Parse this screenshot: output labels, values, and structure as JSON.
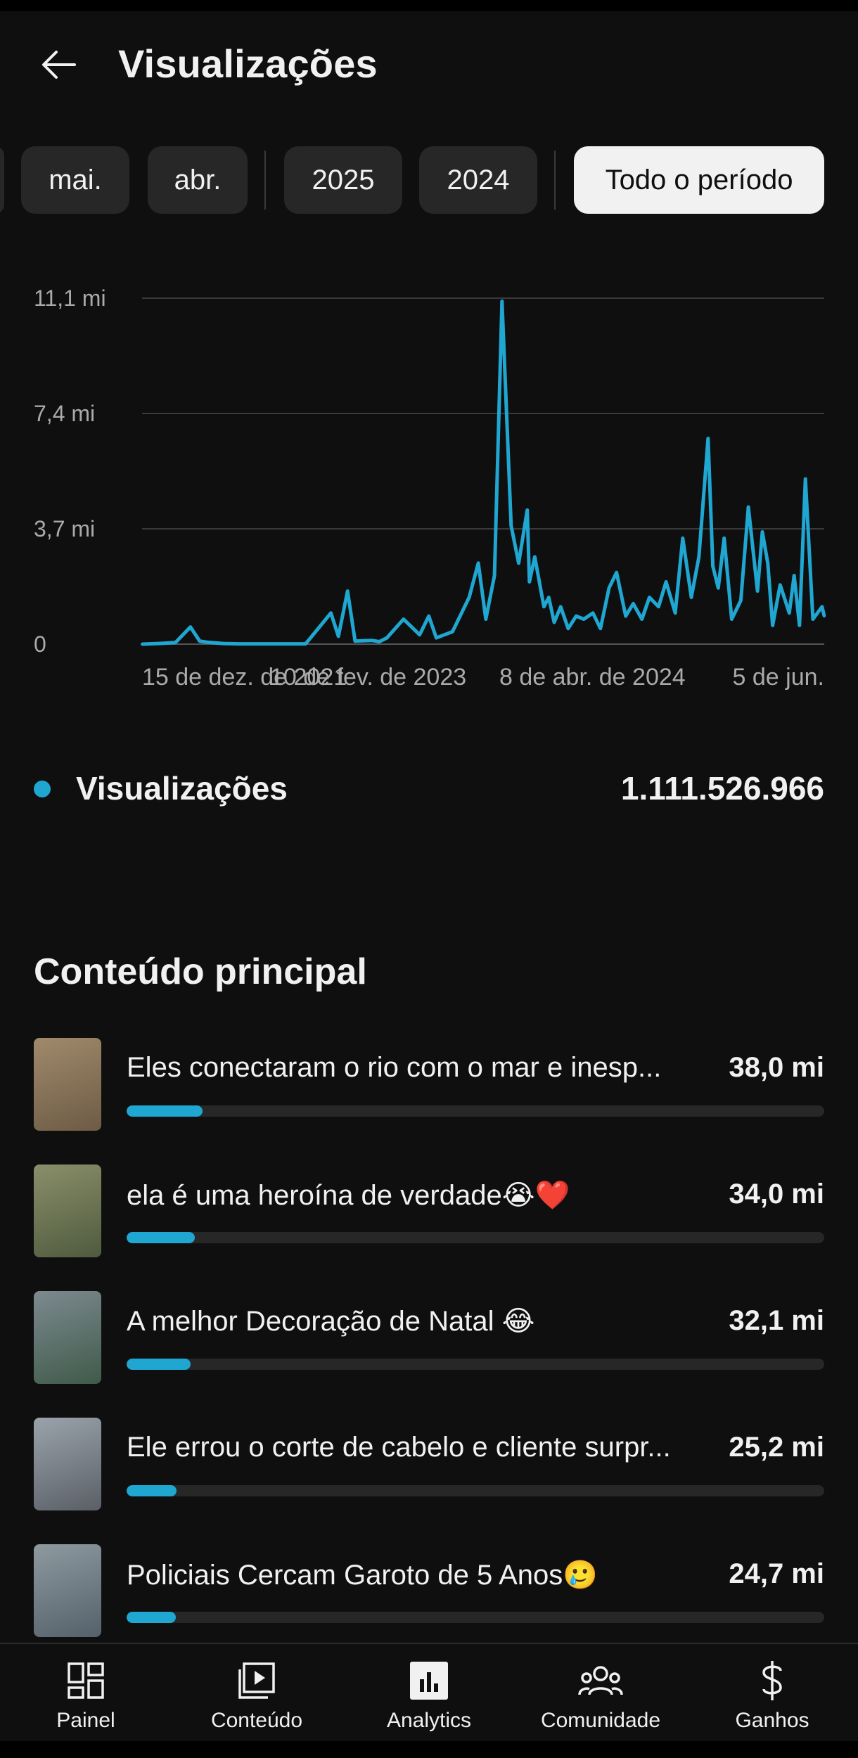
{
  "header": {
    "title": "Visualizações"
  },
  "chips": [
    "mai.",
    "abr.",
    "2025",
    "2024",
    "Todo o período"
  ],
  "chart_data": {
    "type": "line",
    "title": "",
    "xlabel": "",
    "ylabel": "",
    "y_ticks": [
      "11,1 mi",
      "7,4 mi",
      "3,7 mi",
      "0"
    ],
    "x_ticks": [
      "15 de dez. de 2021",
      "10 de fev. de 2023",
      "8 de abr. de 2024",
      "5 de jun."
    ],
    "ylim": [
      0,
      11100000
    ],
    "series_color": "#1fa6d1",
    "series": [
      {
        "name": "",
        "x": [
          "2021-12-15",
          "2022-01-15",
          "2022-02-15",
          "2022-03-15",
          "2022-04-01",
          "2022-04-15",
          "2022-05-01",
          "2022-05-15",
          "2022-06-15",
          "2022-08-15",
          "2022-10-15",
          "2022-12-01",
          "2022-12-15",
          "2023-01-01",
          "2023-01-15",
          "2023-02-15",
          "2023-03-01",
          "2023-03-15",
          "2023-04-15",
          "2023-05-15",
          "2023-06-01",
          "2023-06-15",
          "2023-07-15",
          "2023-08-15",
          "2023-09-01",
          "2023-09-15",
          "2023-10-01",
          "2023-10-15",
          "2023-11-01",
          "2023-11-15",
          "2023-12-01",
          "2023-12-05",
          "2023-12-15",
          "2024-01-01",
          "2024-01-10",
          "2024-01-20",
          "2024-02-01",
          "2024-02-15",
          "2024-03-01",
          "2024-03-15",
          "2024-04-01",
          "2024-04-15",
          "2024-05-01",
          "2024-05-15",
          "2024-06-01",
          "2024-06-15",
          "2024-07-01",
          "2024-07-15",
          "2024-08-01",
          "2024-08-15",
          "2024-09-01",
          "2024-09-15",
          "2024-10-01",
          "2024-10-15",
          "2024-11-01",
          "2024-11-10",
          "2024-11-20",
          "2024-12-01",
          "2024-12-15",
          "2025-01-01",
          "2025-01-15",
          "2025-02-01",
          "2025-02-10",
          "2025-02-20",
          "2025-03-01",
          "2025-03-15",
          "2025-04-01",
          "2025-04-10",
          "2025-04-20",
          "2025-05-01",
          "2025-05-15",
          "2025-06-01",
          "2025-06-05"
        ],
        "values": [
          0,
          20000,
          50000,
          550000,
          100000,
          60000,
          40000,
          20000,
          10000,
          10000,
          10000,
          1000000,
          250000,
          1700000,
          100000,
          120000,
          80000,
          200000,
          800000,
          300000,
          900000,
          200000,
          400000,
          1500000,
          2600000,
          800000,
          2200000,
          11000000,
          3800000,
          2600000,
          4300000,
          2000000,
          2800000,
          1200000,
          1500000,
          700000,
          1200000,
          500000,
          900000,
          800000,
          1000000,
          500000,
          1800000,
          2300000,
          900000,
          1300000,
          800000,
          1500000,
          1200000,
          2000000,
          1000000,
          3400000,
          1500000,
          2800000,
          6600000,
          2500000,
          1800000,
          3400000,
          800000,
          1400000,
          4400000,
          1700000,
          3600000,
          2600000,
          600000,
          1900000,
          1000000,
          2200000,
          600000,
          5300000,
          800000,
          1200000,
          900000
        ]
      }
    ]
  },
  "legend": {
    "label": "Visualizações",
    "total": "1.111.526.966"
  },
  "top_content": {
    "title": "Conteúdo principal",
    "items": [
      {
        "title": "Eles conectaram o rio com o mar e inesp...",
        "value": "38,0 mi",
        "fraction": 0.109,
        "thumb": [
          "#a08a6b",
          "#6d5b45"
        ]
      },
      {
        "title": "ela é uma heroína de verdade😭❤️",
        "value": "34,0 mi",
        "fraction": 0.098,
        "thumb": [
          "#8a8f6a",
          "#4f5a3e"
        ]
      },
      {
        "title": "A melhor Decoração de Natal 😂",
        "value": "32,1 mi",
        "fraction": 0.092,
        "thumb": [
          "#7d8a8f",
          "#3f5a4a"
        ]
      },
      {
        "title": "Ele errou o corte de cabelo e cliente surpr...",
        "value": "25,2 mi",
        "fraction": 0.072,
        "thumb": [
          "#9aa3ab",
          "#5a5f66"
        ]
      },
      {
        "title": "Policiais Cercam Garoto de 5 Anos🥲",
        "value": "24,7 mi",
        "fraction": 0.071,
        "thumb": [
          "#8e9aa0",
          "#55616a"
        ]
      }
    ]
  },
  "nav": [
    {
      "label": "Painel",
      "icon": "dashboard-icon"
    },
    {
      "label": "Conteúdo",
      "icon": "content-icon"
    },
    {
      "label": "Analytics",
      "icon": "analytics-icon"
    },
    {
      "label": "Comunidade",
      "icon": "community-icon"
    },
    {
      "label": "Ganhos",
      "icon": "dollar-icon"
    }
  ]
}
